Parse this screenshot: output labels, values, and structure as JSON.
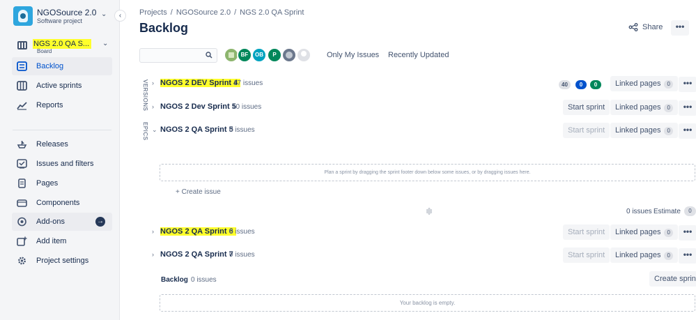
{
  "project": {
    "name": "NGOSource 2.0",
    "type": "Software project"
  },
  "board": {
    "name": "NGS 2.0 QA S...",
    "type": "Board"
  },
  "sidebar": {
    "items": [
      {
        "label": "Backlog",
        "icon": "backlog-icon"
      },
      {
        "label": "Active sprints",
        "icon": "columns-icon"
      },
      {
        "label": "Reports",
        "icon": "chart-icon"
      },
      {
        "label": "Releases",
        "icon": "ship-icon"
      },
      {
        "label": "Issues and filters",
        "icon": "filter-icon"
      },
      {
        "label": "Pages",
        "icon": "page-icon"
      },
      {
        "label": "Components",
        "icon": "component-icon"
      },
      {
        "label": "Add-ons",
        "icon": "addon-icon"
      },
      {
        "label": "Add item",
        "icon": "add-item-icon"
      },
      {
        "label": "Project settings",
        "icon": "settings-icon"
      }
    ]
  },
  "breadcrumb": {
    "items": [
      "Projects",
      "NGOSource 2.0",
      "NGS 2.0 QA Sprint"
    ],
    "separator": "/"
  },
  "header": {
    "title": "Backlog",
    "share_label": "Share",
    "more_label": "•••"
  },
  "filters": {
    "search_placeholder": "",
    "avatars": [
      "BF",
      "OB",
      "P"
    ],
    "quick_filters": [
      "Only My Issues",
      "Recently Updated"
    ]
  },
  "side_tabs": {
    "versions": "VERSIONS",
    "epics": "EPICS"
  },
  "sprints": [
    {
      "name": "NGOS 2 DEV Sprint 4",
      "count": "17 issues",
      "badges": [
        "40",
        "0",
        "0"
      ],
      "linked_label": "Linked pages",
      "linked_count": "0"
    },
    {
      "name": "NGOS 2 Dev Sprint 5",
      "count": "10 issues",
      "action": "Start sprint",
      "linked_label": "Linked pages",
      "linked_count": "0"
    },
    {
      "name": "NGOS 2 QA Sprint 5",
      "count": "0 issues",
      "action": "Start sprint",
      "linked_label": "Linked pages",
      "linked_count": "0"
    },
    {
      "name": "NGOS 2 QA Sprint 6",
      "count": "0 issues",
      "action": "Start sprint",
      "linked_label": "Linked pages",
      "linked_count": "0"
    },
    {
      "name": "NGOS 2 QA Sprint 7",
      "count": "0 issues",
      "action": "Start sprint",
      "linked_label": "Linked pages",
      "linked_count": "0"
    }
  ],
  "open_sprint": {
    "dropzone_text": "Plan a sprint by dragging the sprint footer down below some issues, or by dragging issues here.",
    "create_issue": "+ Create issue",
    "footer_issues": "0 issues",
    "estimate_label": "Estimate",
    "estimate_value": "0"
  },
  "backlog": {
    "label": "Backlog",
    "count": "0 issues",
    "create_sprint": "Create sprint",
    "empty_text": "Your backlog is empty."
  },
  "colors": {
    "highlight": "#ffff2b",
    "accent": "#0052cc",
    "avatar_bf": "#00875a",
    "avatar_ob": "#00a3bf",
    "avatar_p": "#00875a"
  }
}
